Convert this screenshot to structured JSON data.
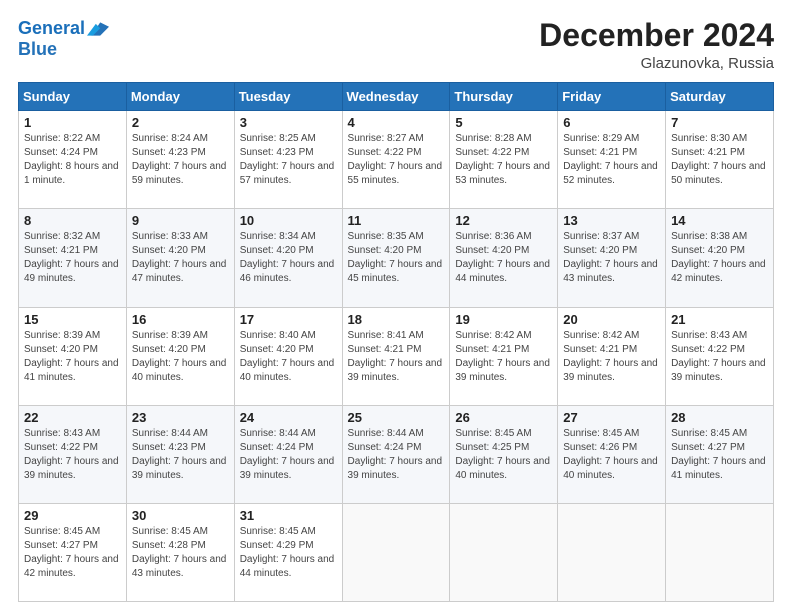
{
  "header": {
    "logo_line1": "General",
    "logo_line2": "Blue",
    "month": "December 2024",
    "location": "Glazunovka, Russia"
  },
  "days_of_week": [
    "Sunday",
    "Monday",
    "Tuesday",
    "Wednesday",
    "Thursday",
    "Friday",
    "Saturday"
  ],
  "weeks": [
    [
      {
        "day": "1",
        "sunrise": "8:22 AM",
        "sunset": "4:24 PM",
        "daylight": "8 hours and 1 minute."
      },
      {
        "day": "2",
        "sunrise": "8:24 AM",
        "sunset": "4:23 PM",
        "daylight": "7 hours and 59 minutes."
      },
      {
        "day": "3",
        "sunrise": "8:25 AM",
        "sunset": "4:23 PM",
        "daylight": "7 hours and 57 minutes."
      },
      {
        "day": "4",
        "sunrise": "8:27 AM",
        "sunset": "4:22 PM",
        "daylight": "7 hours and 55 minutes."
      },
      {
        "day": "5",
        "sunrise": "8:28 AM",
        "sunset": "4:22 PM",
        "daylight": "7 hours and 53 minutes."
      },
      {
        "day": "6",
        "sunrise": "8:29 AM",
        "sunset": "4:21 PM",
        "daylight": "7 hours and 52 minutes."
      },
      {
        "day": "7",
        "sunrise": "8:30 AM",
        "sunset": "4:21 PM",
        "daylight": "7 hours and 50 minutes."
      }
    ],
    [
      {
        "day": "8",
        "sunrise": "8:32 AM",
        "sunset": "4:21 PM",
        "daylight": "7 hours and 49 minutes."
      },
      {
        "day": "9",
        "sunrise": "8:33 AM",
        "sunset": "4:20 PM",
        "daylight": "7 hours and 47 minutes."
      },
      {
        "day": "10",
        "sunrise": "8:34 AM",
        "sunset": "4:20 PM",
        "daylight": "7 hours and 46 minutes."
      },
      {
        "day": "11",
        "sunrise": "8:35 AM",
        "sunset": "4:20 PM",
        "daylight": "7 hours and 45 minutes."
      },
      {
        "day": "12",
        "sunrise": "8:36 AM",
        "sunset": "4:20 PM",
        "daylight": "7 hours and 44 minutes."
      },
      {
        "day": "13",
        "sunrise": "8:37 AM",
        "sunset": "4:20 PM",
        "daylight": "7 hours and 43 minutes."
      },
      {
        "day": "14",
        "sunrise": "8:38 AM",
        "sunset": "4:20 PM",
        "daylight": "7 hours and 42 minutes."
      }
    ],
    [
      {
        "day": "15",
        "sunrise": "8:39 AM",
        "sunset": "4:20 PM",
        "daylight": "7 hours and 41 minutes."
      },
      {
        "day": "16",
        "sunrise": "8:39 AM",
        "sunset": "4:20 PM",
        "daylight": "7 hours and 40 minutes."
      },
      {
        "day": "17",
        "sunrise": "8:40 AM",
        "sunset": "4:20 PM",
        "daylight": "7 hours and 40 minutes."
      },
      {
        "day": "18",
        "sunrise": "8:41 AM",
        "sunset": "4:21 PM",
        "daylight": "7 hours and 39 minutes."
      },
      {
        "day": "19",
        "sunrise": "8:42 AM",
        "sunset": "4:21 PM",
        "daylight": "7 hours and 39 minutes."
      },
      {
        "day": "20",
        "sunrise": "8:42 AM",
        "sunset": "4:21 PM",
        "daylight": "7 hours and 39 minutes."
      },
      {
        "day": "21",
        "sunrise": "8:43 AM",
        "sunset": "4:22 PM",
        "daylight": "7 hours and 39 minutes."
      }
    ],
    [
      {
        "day": "22",
        "sunrise": "8:43 AM",
        "sunset": "4:22 PM",
        "daylight": "7 hours and 39 minutes."
      },
      {
        "day": "23",
        "sunrise": "8:44 AM",
        "sunset": "4:23 PM",
        "daylight": "7 hours and 39 minutes."
      },
      {
        "day": "24",
        "sunrise": "8:44 AM",
        "sunset": "4:24 PM",
        "daylight": "7 hours and 39 minutes."
      },
      {
        "day": "25",
        "sunrise": "8:44 AM",
        "sunset": "4:24 PM",
        "daylight": "7 hours and 39 minutes."
      },
      {
        "day": "26",
        "sunrise": "8:45 AM",
        "sunset": "4:25 PM",
        "daylight": "7 hours and 40 minutes."
      },
      {
        "day": "27",
        "sunrise": "8:45 AM",
        "sunset": "4:26 PM",
        "daylight": "7 hours and 40 minutes."
      },
      {
        "day": "28",
        "sunrise": "8:45 AM",
        "sunset": "4:27 PM",
        "daylight": "7 hours and 41 minutes."
      }
    ],
    [
      {
        "day": "29",
        "sunrise": "8:45 AM",
        "sunset": "4:27 PM",
        "daylight": "7 hours and 42 minutes."
      },
      {
        "day": "30",
        "sunrise": "8:45 AM",
        "sunset": "4:28 PM",
        "daylight": "7 hours and 43 minutes."
      },
      {
        "day": "31",
        "sunrise": "8:45 AM",
        "sunset": "4:29 PM",
        "daylight": "7 hours and 44 minutes."
      },
      null,
      null,
      null,
      null
    ]
  ],
  "labels": {
    "sunrise": "Sunrise:",
    "sunset": "Sunset:",
    "daylight": "Daylight:"
  }
}
